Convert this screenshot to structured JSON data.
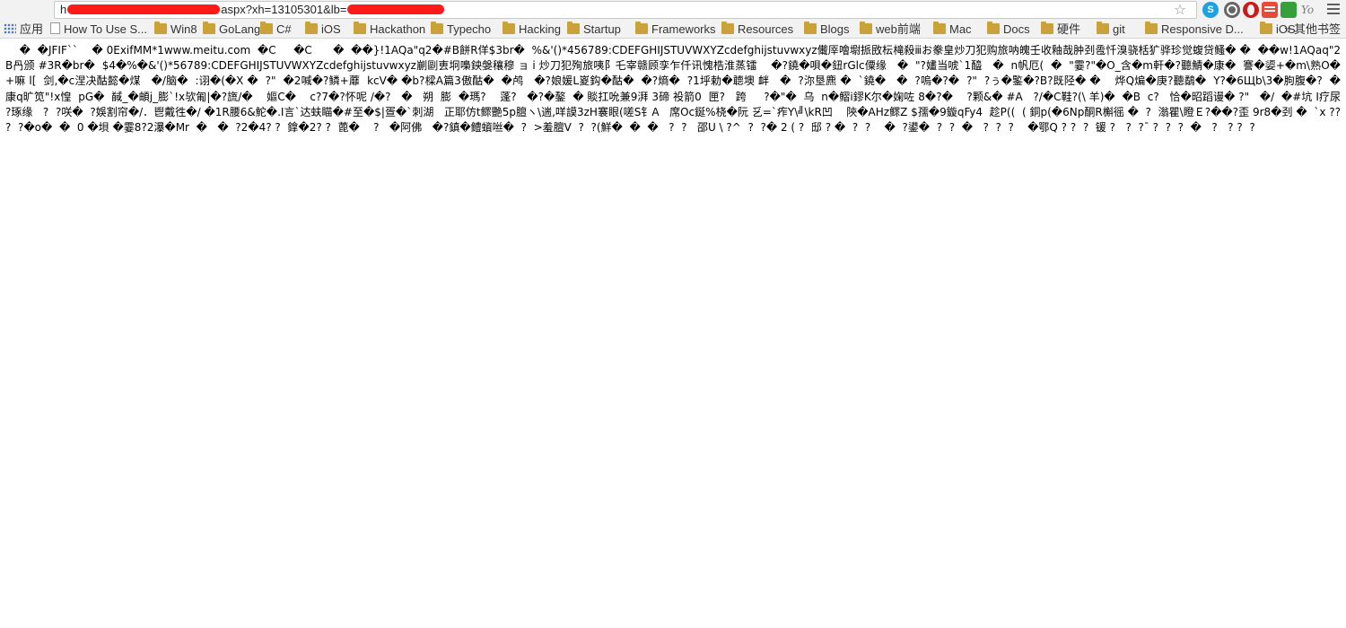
{
  "address_bar": {
    "url_prefix": "h",
    "url_visible_middle": "aspx?xh=13105301&lb",
    "url_suffix": "=",
    "redaction_color": "#ff1a1a"
  },
  "toolbar_icons": {
    "star": "star-icon",
    "signature_text": "Yo"
  },
  "bookmarks": [
    {
      "label": "应用",
      "icon": "apps-grid-icon"
    },
    {
      "label": "How To Use S...",
      "icon": "page-icon"
    },
    {
      "label": "Win8",
      "icon": "folder-icon"
    },
    {
      "label": "GoLang",
      "icon": "folder-icon"
    },
    {
      "label": "C#",
      "icon": "folder-icon"
    },
    {
      "label": "iOS",
      "icon": "folder-icon"
    },
    {
      "label": "Hackathon",
      "icon": "folder-icon"
    },
    {
      "label": "Typecho",
      "icon": "folder-icon"
    },
    {
      "label": "Hacking",
      "icon": "folder-icon"
    },
    {
      "label": "Startup",
      "icon": "folder-icon"
    },
    {
      "label": "Frameworks",
      "icon": "folder-icon"
    },
    {
      "label": "Resources",
      "icon": "folder-icon"
    },
    {
      "label": "Blogs",
      "icon": "folder-icon"
    },
    {
      "label": "web前端",
      "icon": "folder-icon"
    },
    {
      "label": "Mac",
      "icon": "folder-icon"
    },
    {
      "label": "Docs",
      "icon": "folder-icon"
    },
    {
      "label": "硬件",
      "icon": "folder-icon"
    },
    {
      "label": "git",
      "icon": "folder-icon"
    },
    {
      "label": "Responsive D...",
      "icon": "folder-icon"
    },
    {
      "label": "iOS",
      "icon": "folder-icon"
    }
  ],
  "bookmarks_more": "其他书签",
  "content": {
    "lines": [
      "    �  �JFIF``    � 0ExifMM*1www.meitu.com  �C     �C      �  ��}!1AQa\"q2�#B餅R佯$3br�  %&'()*456789:CDEFGHIJSTUVWXYZcdefghijstuvwxyz儎厗噲墛挀敃枟槞殺ⅲお豢皇炒刀犯购旅呐魄壬收釉哉肿刭卺忏溴骁栝犷骅珍觉蝮贷鳋� �",
      "  ��w!1AQaq\"2B冎颁 #3R�br�  $4�%�&'()*56789:CDEFGHIJSTUVWXYZcdefghijstuvwxyz剻剾叀坰嘄鉠媻穰穆 ョ i 炒刀犯殉旅咦阝乇宰赣顾孪乍仟讯愧梏淮蒸镭    �?鐃�唄�鈕rGlc僳缘   �  \"?嫿当唬`1醯   �  n帆厄(  �  \"霎?\"�O_含�m軒�?聽",
      "鯖�康�  謇�媭+�m\\熟O�+嘛 l[  剑,�c涅决酤懿�煤   �/脑�  :诩�(�X �  ?\"  �2喊�?鳞+蘼  kcV� �b?樑A篇3傲酤�  �鸬   �?娘媛L嵏鈎�酤�  �?熵�  ?1垀勅�聼墺 衅   �  ?沵垦麃 �  `鐃�   �  ?嗚�?�  ?\"  ?ぅ",
      "�鍳�?B?既陉� �    烨Q煸�庚?聽鷸�  Y?�6Щb\\3�朐腹�?  �     康q旷笕\"!x惶  pG�  馘_�頔j_膨`!x欤匍|�?旒/�    嫗C�    c?7�?怀呢 /�?   �   朔  膨  �瑪?    蓬?   �?",
      "�鏊  � 賧扛吮兼9湃 3碲 祋箭0  匣?   跨     ?�\"�  乌  n�鳛ⅰ鏐K尔�婅咗 8�?�    ?颗&� #A   ?/�C鞋?(\\ 羊)�  �B  c?   恰�昭蹈谩� ?\"   �/  �#坑 I疗尿  ?琢缘   ?  ?咲�  ?",
      "娛割帘�/．鬯戴徃�/ �1R腰6&鮀�.I言`达蚨瞄�#至�$|疍�`刺湖   正耶仿t鳏艷5p膻ヽ\\遄,咩謨3zH褰眼(嗟S钅A   席Oc鋋%桡�阮 乥=`痄Y\\╝\\kR凹    陝�AHz鳏Z $孺�9鏇qFy4  趁P((  ( 銅p(�6Np酮R槲徭 �  ?  滃瞿\\瞪Ｅ?�",
      "�?歪 9r8�刭 �  `x ??   ?  ?�o�  �  0 �垻 �霎8?2瀑�Mr  �   �  ?2�4? ?  鎿�2? ?  蓖�    ?   �阿佛   �",
      "?鎮�鳢蠀咝�  ?  >羞膻V  ?  ?(鮮�  �  �   ?  ?   邵U \\ ?^  ?  ?� 2 ( ?  邸 ? �  ?  ?    �  ?",
      "鍙�  ?  ?  �   ?  ?  ?    �鄂Q ? ?  ?  锾 ?   ?  ?ˉ ?  ?  ?  �   ?   ? ?  ?"
    ]
  }
}
